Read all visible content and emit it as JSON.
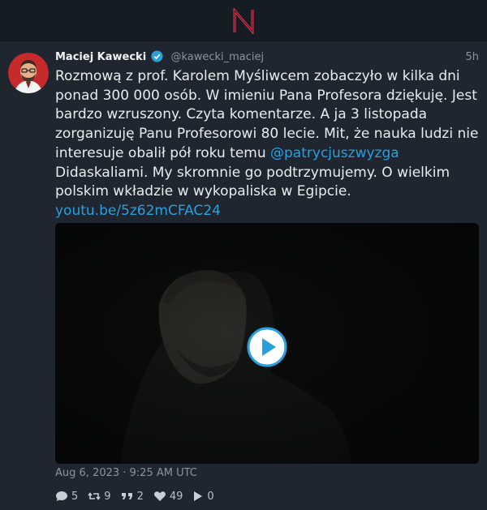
{
  "app": {
    "logo_icon": "nitter-logo-icon",
    "accent_color": "#ff2e4a"
  },
  "tweet": {
    "fullname": "Maciej Kawecki",
    "username": "@kawecki_maciej",
    "verified_icon": "verified-badge-icon",
    "time_ago": "5h",
    "text_parts": {
      "p1": "Rozmową z prof. Karolem Myśliwcem zobaczyło w kilka dni ponad 300 000 osób. W imieniu Pana Profesora dziękuję. Jest bardzo wzruszony. Czyta komentarze. A ja 3 listopada zorganizuję Panu Profesorowi 80 lecie. Mit, że nauka ludzi nie interesuje obalił pół roku temu ",
      "mention": "@patrycjuszwyzga",
      "p2": " Didaskaliami. My skromnie go podtrzymujemy. O wielkim polskim wkładzie w wykopaliska w Egipcie.",
      "link": "youtu.be/5z62mCFAC24"
    },
    "date": "Aug 6, 2023 · 9:25 AM UTC",
    "stats": {
      "replies": "5",
      "retweets": "9",
      "quotes": "2",
      "likes": "49",
      "plays": "0"
    },
    "colors": {
      "link": "#2a9fde",
      "background": "#1f262f"
    }
  }
}
